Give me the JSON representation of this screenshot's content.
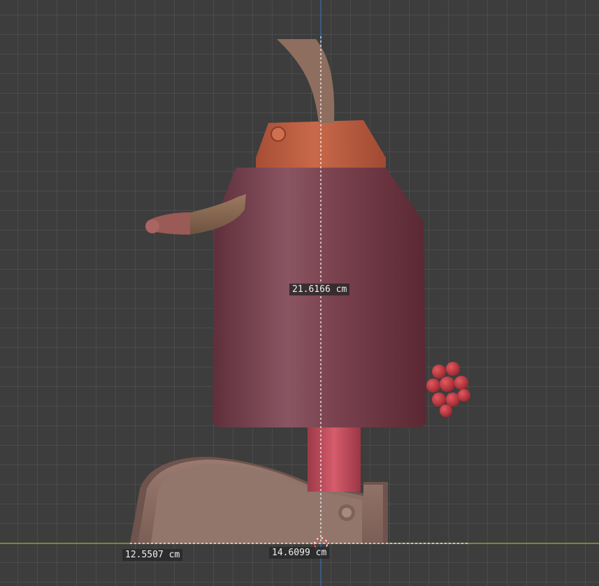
{
  "viewport": {
    "background_color": "#3d3d3d",
    "grid_color": "#4a4a4a",
    "x_axis_color": "#7da33a",
    "z_axis_color": "#3a6fb5"
  },
  "measurements": {
    "height": "21.6166 cm",
    "width_left": "12.5507 cm",
    "width_right": "14.6099 cm"
  },
  "model": {
    "icon": "robot-model-icon",
    "colors": {
      "body": "#7a3f4c",
      "cap": "#b55a3c",
      "arm": "#8a6a57",
      "hand": "#9a5a5a",
      "neck": "#b84a58",
      "base": "#8b6e64",
      "berries": "#c03a40"
    }
  }
}
